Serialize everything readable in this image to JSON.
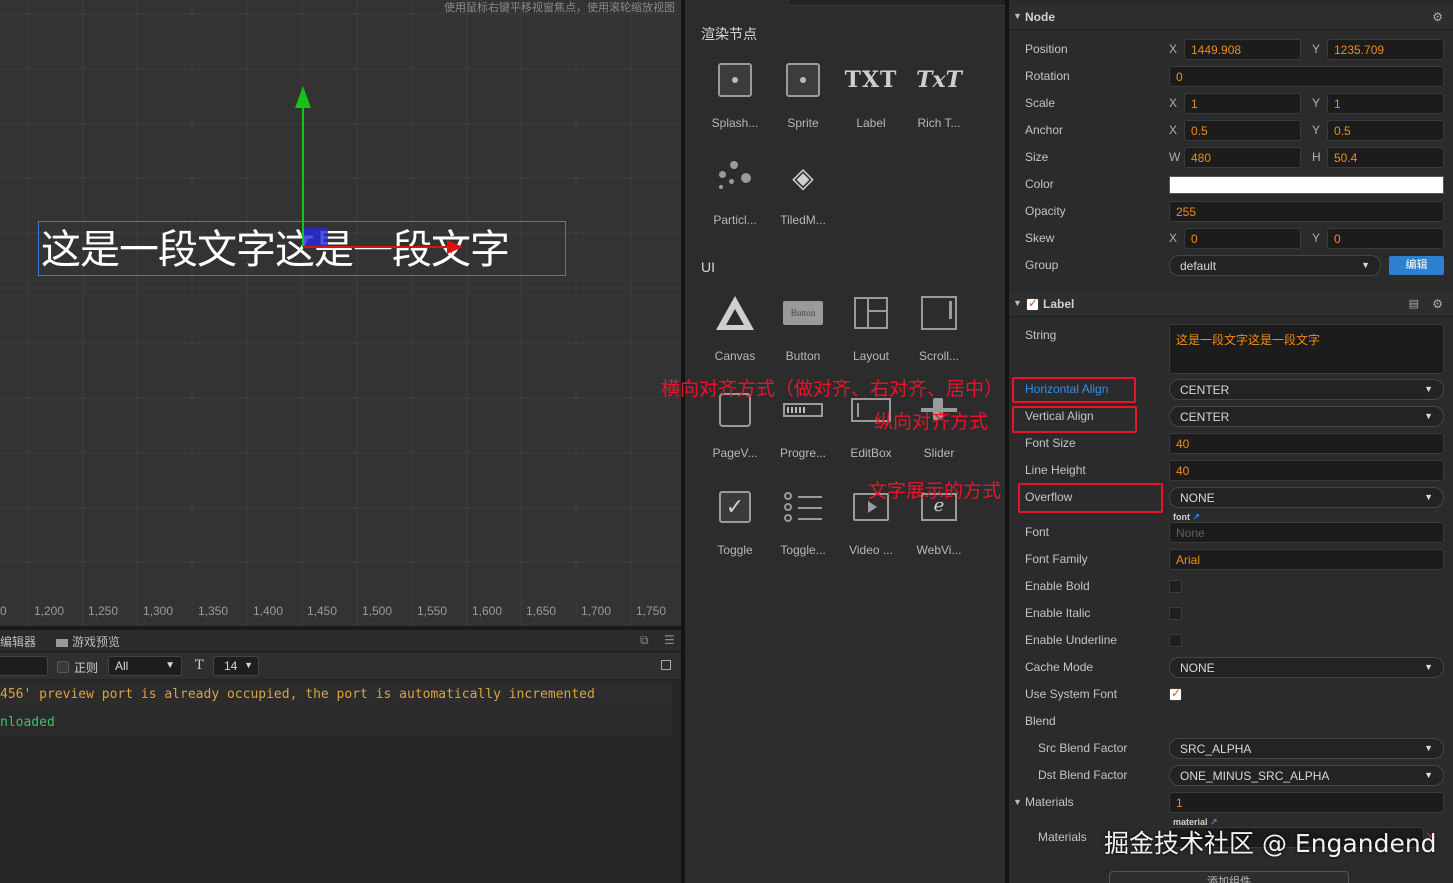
{
  "scene": {
    "hint": "使用鼠标右键平移视窗焦点，使用滚轮缩放视图",
    "label_text": "这是一段文字这是一段文字",
    "ruler_ticks": [
      "0",
      "1,200",
      "1,250",
      "1,300",
      "1,350",
      "1,400",
      "1,450",
      "1,500",
      "1,550",
      "1,600",
      "1,650",
      "1,700",
      "1,750"
    ]
  },
  "console": {
    "tabs": {
      "editor": "编辑器",
      "game_preview": "游戏预览"
    },
    "regex_label": "正则",
    "level": "All",
    "font_size": "14",
    "logs": [
      {
        "text": "456' preview port is already occupied, the port is automatically incremented",
        "level": "warn"
      },
      {
        "text": "nloaded",
        "level": "success"
      }
    ]
  },
  "library": {
    "render_section": "渲染节点",
    "ui_section": "UI",
    "render_items": [
      "Splash...",
      "Sprite",
      "Label",
      "Rich T...",
      "Particl...",
      "TiledM..."
    ],
    "ui_items": [
      "Canvas",
      "Button",
      "Layout",
      "Scroll...",
      "PageV...",
      "Progre...",
      "EditBox",
      "Slider",
      "Toggle",
      "Toggle...",
      "Video ...",
      "WebVi..."
    ],
    "button_icon_text": "Button",
    "txt_icon_text": "TXT",
    "rich_icon_text": "TxT"
  },
  "inspector": {
    "node": {
      "title": "Node",
      "position": {
        "label": "Position",
        "x": "1449.908",
        "y": "1235.709"
      },
      "rotation": {
        "label": "Rotation",
        "value": "0"
      },
      "scale": {
        "label": "Scale",
        "x": "1",
        "y": "1"
      },
      "anchor": {
        "label": "Anchor",
        "x": "0.5",
        "y": "0.5"
      },
      "size": {
        "label": "Size",
        "w": "480",
        "h": "50.4"
      },
      "color": {
        "label": "Color",
        "value": "#ffffff"
      },
      "opacity": {
        "label": "Opacity",
        "value": "255"
      },
      "skew": {
        "label": "Skew",
        "x": "0",
        "y": "0"
      },
      "group": {
        "label": "Group",
        "value": "default",
        "edit_button": "编辑"
      }
    },
    "axis": {
      "x": "X",
      "y": "Y",
      "w": "W",
      "h": "H"
    },
    "label": {
      "title": "Label",
      "string": {
        "label": "String",
        "value": "这是一段文字这是一段文字"
      },
      "horizontal_align": {
        "label": "Horizontal Align",
        "value": "CENTER"
      },
      "vertical_align": {
        "label": "Vertical Align",
        "value": "CENTER"
      },
      "font_size": {
        "label": "Font Size",
        "value": "40"
      },
      "line_height": {
        "label": "Line Height",
        "value": "40"
      },
      "overflow": {
        "label": "Overflow",
        "value": "NONE"
      },
      "font_tag": "font",
      "font": {
        "label": "Font",
        "value": "None"
      },
      "font_family": {
        "label": "Font Family",
        "value": "Arial"
      },
      "enable_bold": {
        "label": "Enable Bold",
        "checked": false
      },
      "enable_italic": {
        "label": "Enable Italic",
        "checked": false
      },
      "enable_underline": {
        "label": "Enable Underline",
        "checked": false
      },
      "cache_mode": {
        "label": "Cache Mode",
        "value": "NONE"
      },
      "use_system_font": {
        "label": "Use System Font",
        "checked": true
      },
      "blend": {
        "label": "Blend"
      },
      "src_blend": {
        "label": "Src Blend Factor",
        "value": "SRC_ALPHA"
      },
      "dst_blend": {
        "label": "Dst Blend Factor",
        "value": "ONE_MINUS_SRC_ALPHA"
      },
      "materials_count": {
        "label": "Materials",
        "value": "1"
      },
      "material_tag": "material",
      "materials": {
        "label": "Materials"
      }
    },
    "add_component": "添加组件"
  },
  "annotations": {
    "h_align": "横向对齐方式（做对齐、右对齐、居中）",
    "v_align": "纵向对齐方式",
    "overflow": "文字展示的方式",
    "watermark": "掘金技术社区 @ Engandend"
  },
  "colors": {
    "accent": "#2f7fd1",
    "value_text": "#f08c1a",
    "annotation": "#e8152a"
  }
}
